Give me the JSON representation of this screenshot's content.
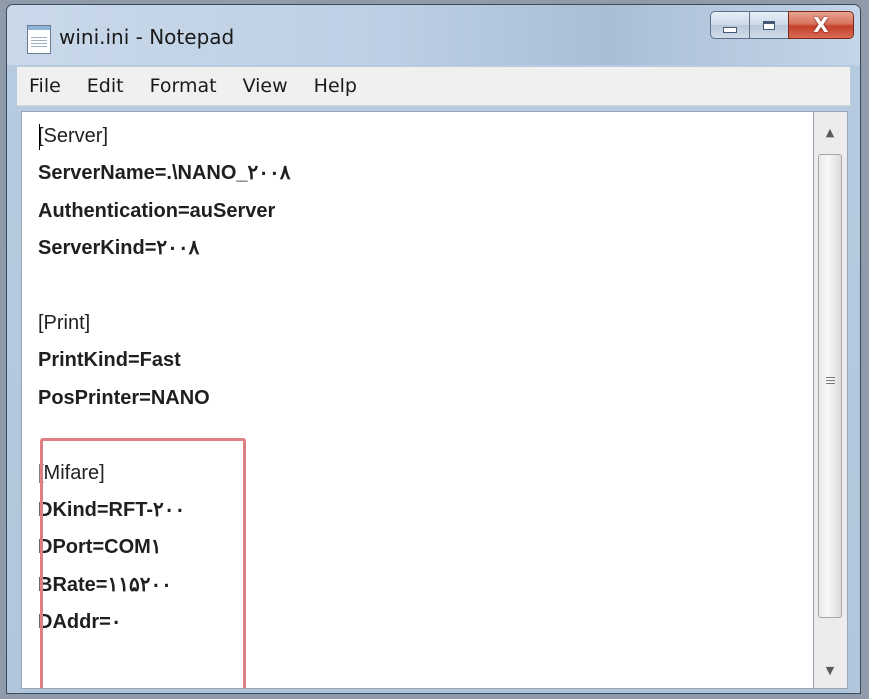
{
  "window": {
    "title": "wini.ini - Notepad",
    "icon": "notepad-icon",
    "buttons": {
      "minimize": "minimize-icon",
      "maximize": "maximize-icon",
      "close": "close-icon",
      "close_glyph": "X"
    }
  },
  "menu": [
    "File",
    "Edit",
    "Format",
    "View",
    "Help"
  ],
  "editor": {
    "lines": [
      "[Server]",
      "ServerName=.\\NANO_۲۰۰۸",
      "Authentication=auServer",
      "ServerKind=۲۰۰۸",
      "",
      "[Print]",
      "PrintKind=Fast",
      "PosPrinter=NANO",
      "",
      "[Mifare]",
      "DKind=RFT-۲۰۰",
      "DPort=COM۱",
      "BRate=۱۱۵۲۰۰",
      "DAddr=۰"
    ]
  },
  "colors": {
    "highlight_border": "#e07f83",
    "close_button": "#c4412b",
    "title_bar": "#bccfe4"
  }
}
